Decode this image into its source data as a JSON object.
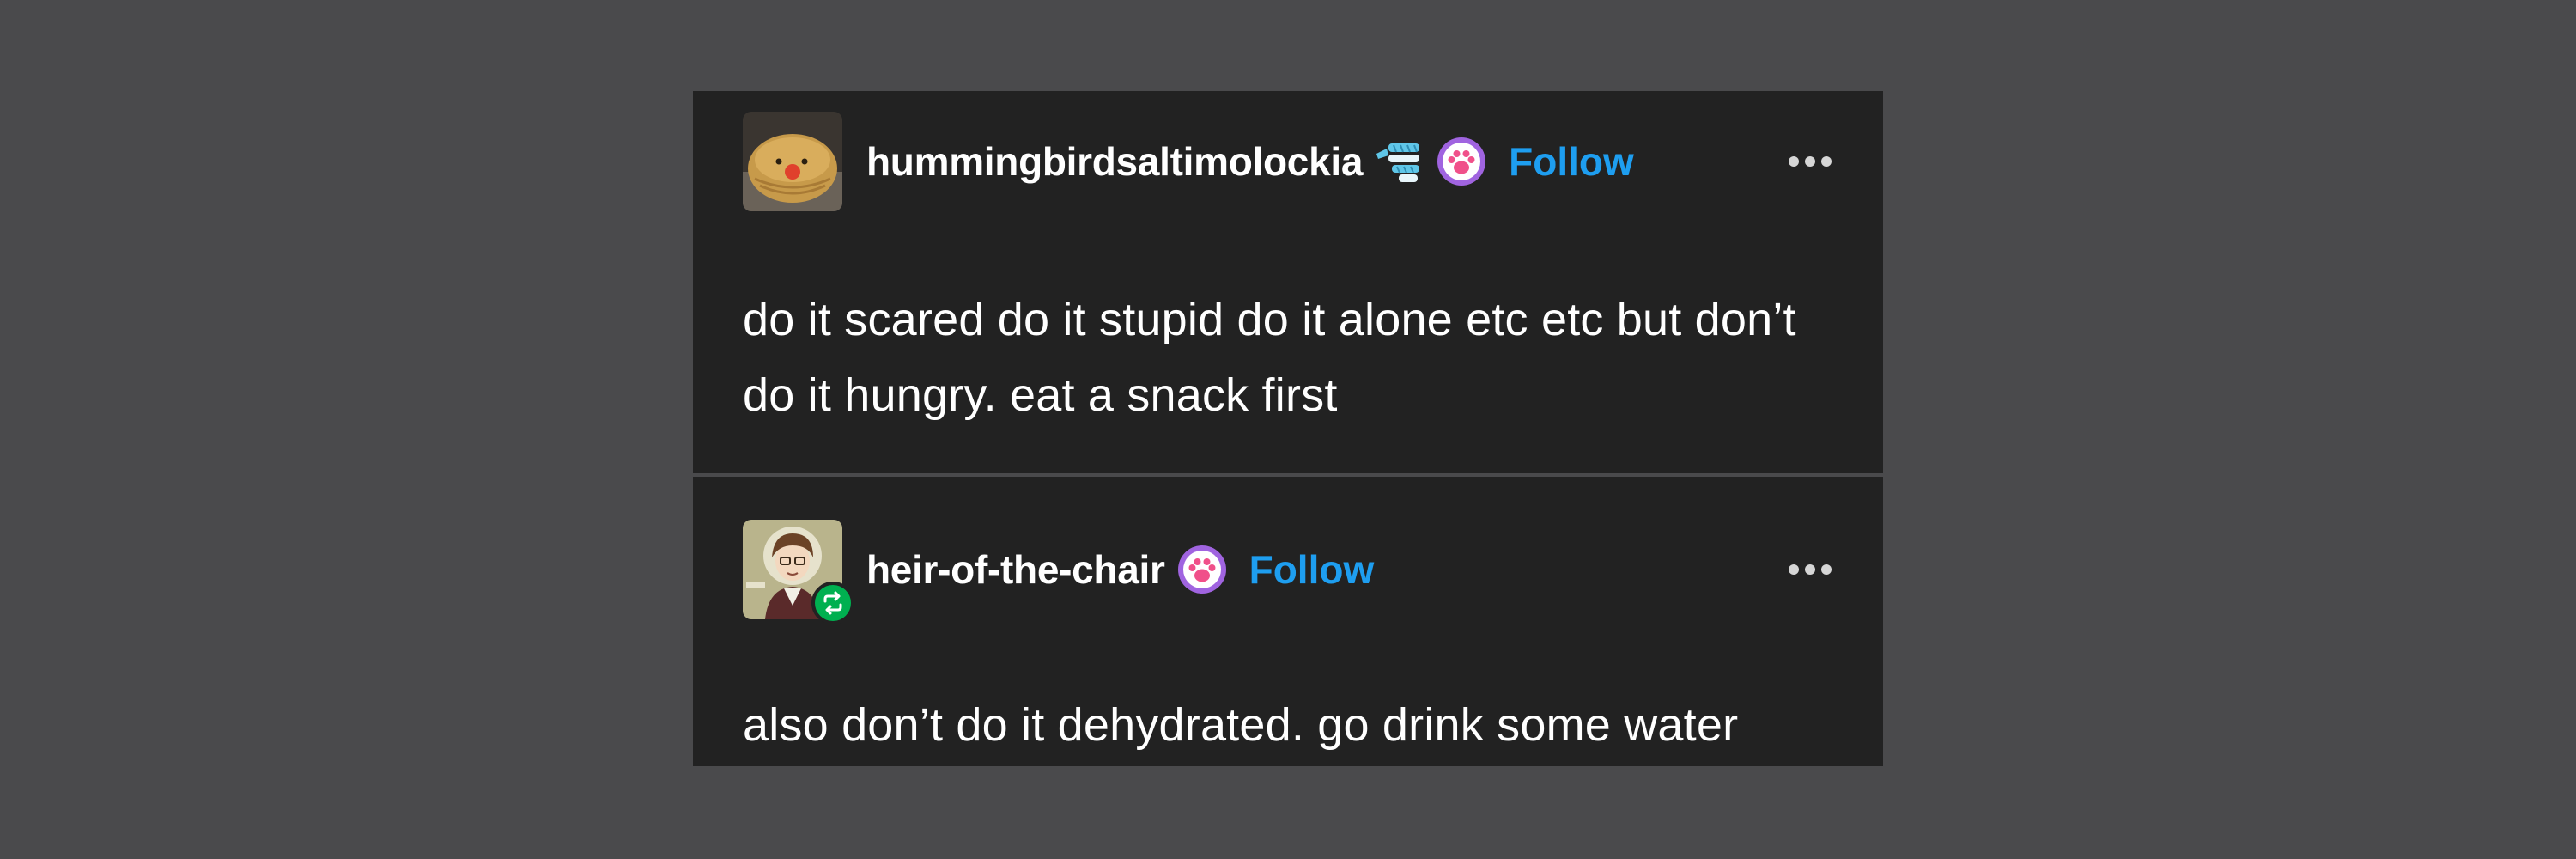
{
  "posts": [
    {
      "username": "hummingbirdsaltimolockia",
      "follow_label": "Follow",
      "body": "do it scared do it stupid do it alone etc etc but don’t do it hungry. eat a snack first",
      "icons": [
        "potato-avatar",
        "scarf-badge-icon",
        "paw-badge-icon",
        "more-options-icon"
      ]
    },
    {
      "username": "heir-of-the-chair",
      "follow_label": "Follow",
      "body": "also don’t do it dehydrated. go drink some water",
      "icons": [
        "character-avatar",
        "reblog-icon",
        "paw-badge-icon",
        "more-options-icon"
      ]
    }
  ],
  "colors": {
    "background": "#4a4a4c",
    "card": "#222222",
    "text": "#ffffff",
    "follow": "#1e9ef0",
    "reblog_badge": "#00b050",
    "paw_badge": "#a064e0"
  }
}
